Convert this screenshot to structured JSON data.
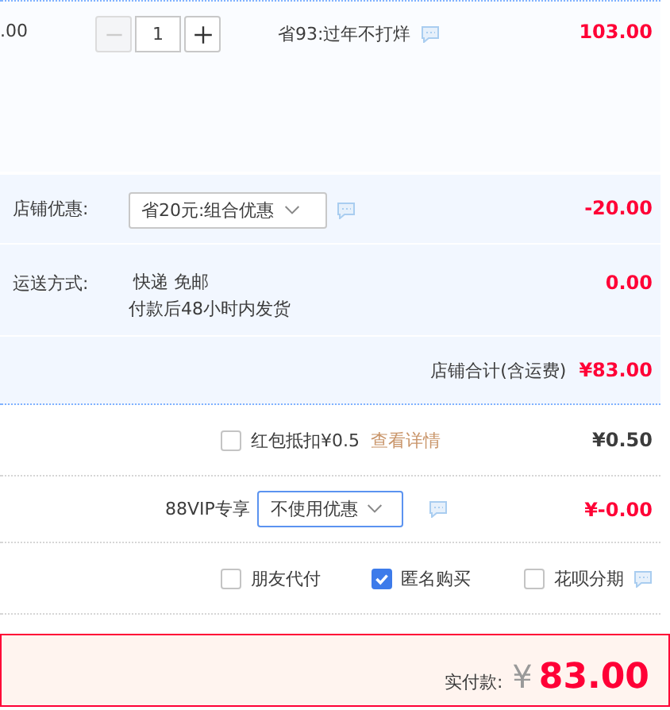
{
  "item": {
    "unit_price": ".00",
    "quantity": "1",
    "promotion": "省93:过年不打烊",
    "subtotal": "103.00"
  },
  "shop": {
    "discount": {
      "label": "店铺优惠:",
      "value": "省20元:组合优惠",
      "amount": "-20.00"
    },
    "shipping": {
      "label": "运送方式:",
      "method": "快递 免邮",
      "note": "付款后48小时内发货",
      "amount": "0.00"
    },
    "total": {
      "label": "店铺合计(含运费)",
      "amount": "¥83.00"
    }
  },
  "red_packet": {
    "checked": false,
    "label": "红包抵扣¥0.5",
    "link": "查看详情",
    "amount": "¥0.50"
  },
  "vip": {
    "label": "88VIP专享",
    "value": "不使用优惠",
    "amount": "¥-0.00"
  },
  "options": [
    {
      "label": "朋友代付",
      "checked": false,
      "info": false
    },
    {
      "label": "匿名购买",
      "checked": true,
      "info": false
    },
    {
      "label": "花呗分期",
      "checked": false,
      "info": true
    }
  ],
  "payment": {
    "label": "实付款:",
    "currency": "¥",
    "amount": "83.00"
  }
}
